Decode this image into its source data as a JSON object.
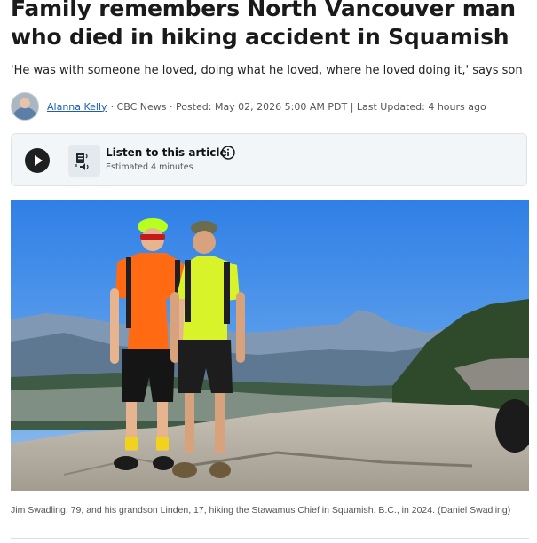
{
  "article": {
    "headline": "Family remembers North Vancouver man who died in hiking accident in Squamish",
    "subhead": "'He was with someone he loved, doing what he loved, where he loved doing it,' says son"
  },
  "byline": {
    "author": "Alanna Kelly",
    "meta": "· CBC News · Posted: May 02, 2026 5:00 AM PDT | Last Updated: 4 hours ago"
  },
  "listen": {
    "title": "Listen to this article",
    "estimate": "Estimated 4 minutes"
  },
  "photo": {
    "caption": "Jim Swadling, 79, and his grandson Linden, 17, hiking the Stawamus Chief in Squamish, B.C., in 2024. (Daniel Swadling)"
  },
  "icons": {
    "play": "play-icon",
    "listen": "audio-document-icon",
    "info": "info-icon"
  },
  "colors": {
    "link": "#1a5fb4",
    "listen_bg": "#f2f6f8",
    "play_button": "#1f1f1f"
  }
}
